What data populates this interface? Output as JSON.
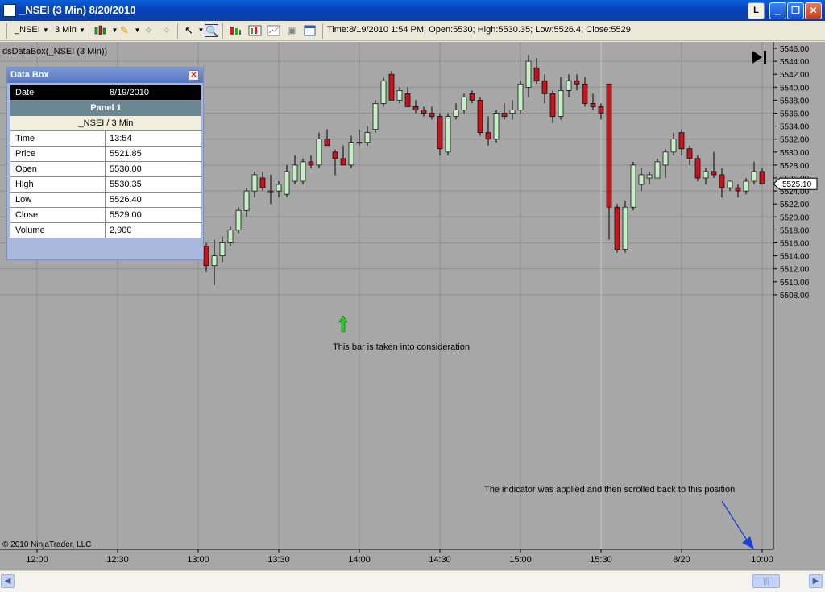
{
  "window": {
    "title": "_NSEI (3 Min)  8/20/2010",
    "btn_L": "L",
    "min_glyph": "_",
    "max_glyph": "❐",
    "close_glyph": "✕"
  },
  "toolbar": {
    "instrument": "_NSEI",
    "interval": "3 Min",
    "bar_info": "Time:8/19/2010 1:54 PM; Open:5530; High:5530.35; Low:5526.4; Close:5529"
  },
  "chart": {
    "indicator_label": "dsDataBox(_NSEI (3 Min))",
    "copyright": "© 2010 NinjaTrader, LLC",
    "note_bar": "This bar is taken into consideration",
    "note_scroll": "The indicator was applied and then scrolled back to this position",
    "current_price": "5525.10",
    "colors": {
      "background": "#a7a7a7",
      "up": "#c4f0c4",
      "down": "#c8141c",
      "grid": "#8f8f8f",
      "arrow_green": "#22cc22",
      "arrow_blue": "#1c3fd8"
    }
  },
  "chart_data": {
    "type": "candlestick",
    "y_ticks": [
      "5546.00",
      "5544.00",
      "5542.00",
      "5540.00",
      "5538.00",
      "5536.00",
      "5534.00",
      "5532.00",
      "5530.00",
      "5528.00",
      "5526.00",
      "5524.00",
      "5522.00",
      "5520.00",
      "5518.00",
      "5516.00",
      "5514.00",
      "5512.00",
      "5510.00",
      "5508.00"
    ],
    "x_ticks": [
      "12:00",
      "12:30",
      "13:00",
      "13:30",
      "14:00",
      "14:30",
      "15:00",
      "15:30",
      "8/20",
      "10:00"
    ],
    "ylim": [
      5507,
      5546.5
    ],
    "candles": [
      [
        5528.5,
        5529.5,
        5527.0,
        5527.5
      ],
      [
        5527.5,
        5528.5,
        5525.5,
        5526.0
      ],
      [
        5526.0,
        5531.0,
        5525.0,
        5530.0
      ],
      [
        5528.5,
        5529.5,
        5525.5,
        5526.0
      ],
      [
        5526.0,
        5530.5,
        5526.0,
        5530.0
      ],
      [
        5527.5,
        5530.0,
        5526.0,
        5528.5
      ],
      [
        5528.5,
        5529.0,
        5528.0,
        5528.0
      ],
      [
        5528.5,
        5530.0,
        5526.5,
        5529.5
      ],
      [
        5530.0,
        5530.5,
        5526.0,
        5529.0
      ],
      [
        5529.0,
        5530.0,
        5525.0,
        5526.0
      ],
      [
        5526.0,
        5531.0,
        5525.0,
        5530.5
      ],
      [
        5529.5,
        5531.0,
        5526.0,
        5527.0
      ],
      [
        5528.5,
        5530.0,
        5526.5,
        5528.0
      ],
      [
        5530.5,
        5531.0,
        5527.0,
        5528.0
      ],
      [
        5529.5,
        5531.0,
        5527.0,
        5528.0
      ],
      [
        5528.0,
        5529.0,
        5525.5,
        5528.0
      ],
      [
        5528.0,
        5530.5,
        5526.0,
        5530.0
      ],
      [
        5529.0,
        5530.5,
        5527.5,
        5528.5
      ],
      [
        5528.5,
        5529.5,
        5528.0,
        5528.5
      ],
      [
        5528.0,
        5529.5,
        5527.5,
        5529.0
      ],
      [
        5530.0,
        5530.5,
        5526.5,
        5526.5
      ],
      [
        5526.5,
        5527.0,
        5523.0,
        5523.5
      ],
      [
        5523.5,
        5526.5,
        5523.0,
        5525.5
      ],
      [
        5525.0,
        5525.5,
        5514.5,
        5515.5
      ],
      [
        5515.5,
        5516.0,
        5511.5,
        5512.5
      ],
      [
        5512.5,
        5516.5,
        5509.5,
        5514.0
      ],
      [
        5514.0,
        5517.0,
        5513.0,
        5516.0
      ],
      [
        5516.0,
        5518.5,
        5515.5,
        5518.0
      ],
      [
        5518.0,
        5521.5,
        5517.5,
        5521.0
      ],
      [
        5521.0,
        5524.5,
        5520.0,
        5524.0
      ],
      [
        5524.0,
        5527.0,
        5523.0,
        5526.5
      ],
      [
        5526.0,
        5527.0,
        5524.0,
        5524.5
      ],
      [
        5524.0,
        5526.5,
        5522.0,
        5524.0
      ],
      [
        5524.0,
        5525.5,
        5523.0,
        5525.0
      ],
      [
        5523.5,
        5528.0,
        5523.0,
        5527.0
      ],
      [
        5525.5,
        5529.5,
        5525.0,
        5528.0
      ],
      [
        5525.5,
        5529.0,
        5525.0,
        5528.5
      ],
      [
        5528.5,
        5529.5,
        5527.5,
        5528.0
      ],
      [
        5528.0,
        5533.0,
        5527.5,
        5532.0
      ],
      [
        5532.0,
        5533.5,
        5531.0,
        5531.0
      ],
      [
        5530.0,
        5530.35,
        5526.4,
        5529.0
      ],
      [
        5529.0,
        5531.0,
        5528.0,
        5528.0
      ],
      [
        5528.0,
        5532.5,
        5527.5,
        5531.5
      ],
      [
        5531.5,
        5533.5,
        5531.0,
        5531.5
      ],
      [
        5531.5,
        5534.0,
        5531.0,
        5533.0
      ],
      [
        5533.5,
        5538.0,
        5533.0,
        5537.5
      ],
      [
        5537.5,
        5541.5,
        5537.0,
        5541.0
      ],
      [
        5542.0,
        5542.5,
        5538.0,
        5538.0
      ],
      [
        5538.0,
        5540.0,
        5537.5,
        5539.5
      ],
      [
        5539.0,
        5540.0,
        5537.0,
        5537.0
      ],
      [
        5537.0,
        5538.0,
        5536.0,
        5536.5
      ],
      [
        5536.5,
        5537.0,
        5535.5,
        5536.0
      ],
      [
        5536.0,
        5537.0,
        5535.0,
        5535.5
      ],
      [
        5535.5,
        5536.0,
        5529.5,
        5530.5
      ],
      [
        5530.0,
        5536.0,
        5529.5,
        5535.5
      ],
      [
        5535.5,
        5537.5,
        5535.0,
        5536.5
      ],
      [
        5536.5,
        5539.0,
        5536.0,
        5538.5
      ],
      [
        5539.0,
        5539.5,
        5537.5,
        5538.0
      ],
      [
        5538.0,
        5538.5,
        5532.5,
        5533.0
      ],
      [
        5533.0,
        5535.5,
        5531.0,
        5532.0
      ],
      [
        5532.0,
        5536.5,
        5531.5,
        5536.0
      ],
      [
        5536.0,
        5537.5,
        5535.0,
        5535.5
      ],
      [
        5536.0,
        5538.0,
        5535.0,
        5536.5
      ],
      [
        5536.5,
        5541.0,
        5536.0,
        5540.5
      ],
      [
        5540.0,
        5545.0,
        5538.5,
        5544.0
      ],
      [
        5543.0,
        5544.5,
        5540.5,
        5541.0
      ],
      [
        5541.0,
        5542.0,
        5537.5,
        5539.0
      ],
      [
        5539.0,
        5539.5,
        5534.5,
        5535.5
      ],
      [
        5535.5,
        5541.5,
        5535.0,
        5539.5
      ],
      [
        5539.5,
        5542.0,
        5538.5,
        5541.0
      ],
      [
        5541.0,
        5542.0,
        5539.5,
        5540.5
      ],
      [
        5540.5,
        5541.5,
        5537.0,
        5537.5
      ],
      [
        5537.5,
        5539.0,
        5536.5,
        5537.0
      ],
      [
        5537.0,
        5537.5,
        5535.0,
        5536.0
      ],
      [
        5540.5,
        5540.5,
        5516.5,
        5521.5
      ],
      [
        5521.5,
        5522.0,
        5514.5,
        5515.0
      ],
      [
        5515.0,
        5522.5,
        5514.5,
        5521.5
      ],
      [
        5521.5,
        5528.5,
        5521.0,
        5528.0
      ],
      [
        5525.0,
        5527.5,
        5524.0,
        5526.5
      ],
      [
        5526.0,
        5527.0,
        5525.0,
        5526.5
      ],
      [
        5526.0,
        5529.0,
        5526.0,
        5528.5
      ],
      [
        5528.0,
        5530.5,
        5526.0,
        5530.0
      ],
      [
        5530.0,
        5533.0,
        5529.5,
        5532.0
      ],
      [
        5533.0,
        5533.5,
        5529.5,
        5530.5
      ],
      [
        5530.5,
        5531.0,
        5528.0,
        5529.0
      ],
      [
        5529.0,
        5529.5,
        5525.5,
        5526.0
      ],
      [
        5526.0,
        5527.5,
        5525.0,
        5527.0
      ],
      [
        5527.0,
        5530.0,
        5526.0,
        5526.5
      ],
      [
        5526.5,
        5527.5,
        5523.0,
        5524.5
      ],
      [
        5524.5,
        5525.5,
        5524.0,
        5525.5
      ],
      [
        5524.5,
        5525.0,
        5523.0,
        5524.0
      ],
      [
        5524.0,
        5526.0,
        5523.5,
        5525.5
      ],
      [
        5525.5,
        5528.5,
        5525.0,
        5527.0
      ],
      [
        5527.0,
        5527.5,
        5525.0,
        5525.1
      ]
    ]
  },
  "databox": {
    "title": "Data Box",
    "close_glyph": "✕",
    "date_label": "Date",
    "date_value": "8/19/2010",
    "panel": "Panel 1",
    "series": "_NSEI / 3 Min",
    "rows": [
      {
        "k": "Time",
        "v": "13:54"
      },
      {
        "k": "Price",
        "v": "5521.85"
      },
      {
        "k": "Open",
        "v": "5530.00"
      },
      {
        "k": "High",
        "v": "5530.35"
      },
      {
        "k": "Low",
        "v": "5526.40"
      },
      {
        "k": "Close",
        "v": "5529.00"
      },
      {
        "k": "Volume",
        "v": "2,900"
      }
    ]
  },
  "scrollbar": {
    "left_glyph": "◀",
    "right_glyph": "▶",
    "thumb_glyph": "|||"
  }
}
